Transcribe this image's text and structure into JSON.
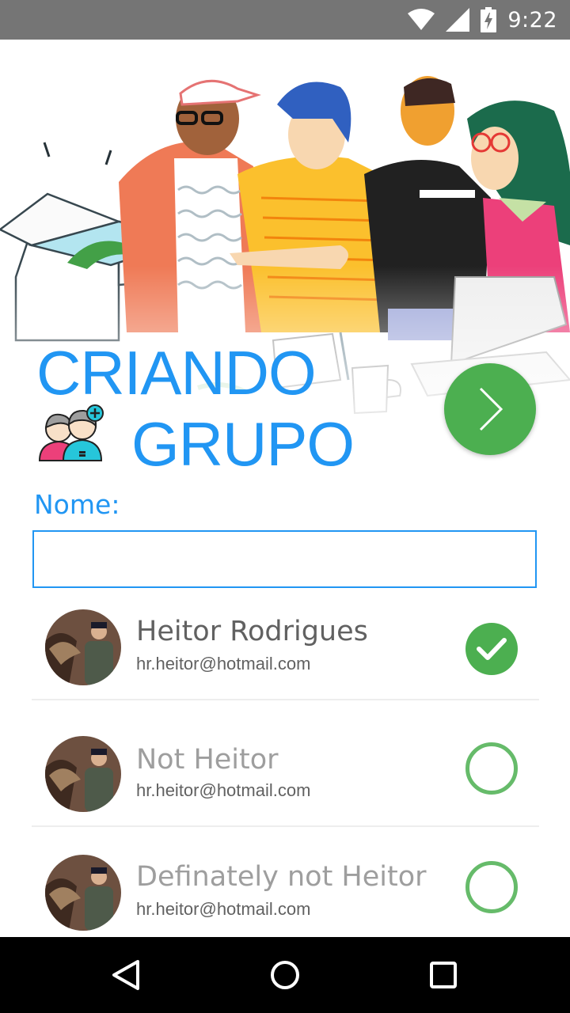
{
  "status_bar": {
    "time": "9:22",
    "icons": [
      "wifi-icon",
      "signal-icon",
      "battery-charging-icon"
    ],
    "background": "#757575"
  },
  "header": {
    "title_line1": "CRIANDO",
    "title_line2": "GRUPO",
    "title_color": "#2196f3",
    "group_icon": "group-add-icon",
    "next_icon": "chevron-right-icon",
    "next_color": "#4caf50"
  },
  "form": {
    "name_label": "Nome:",
    "name_value": "",
    "name_placeholder": ""
  },
  "contacts": [
    {
      "name": "Heitor Rodrigues",
      "email": "hr.heitor@hotmail.com",
      "selected": true
    },
    {
      "name": "Not Heitor",
      "email": "hr.heitor@hotmail.com",
      "selected": false
    },
    {
      "name": "Definately not Heitor",
      "email": "hr.heitor@hotmail.com",
      "selected": false
    }
  ],
  "nav_bar": {
    "buttons": [
      "back-icon",
      "home-icon",
      "recents-icon"
    ]
  },
  "colors": {
    "accent_blue": "#2196f3",
    "accent_green": "#4caf50",
    "selected_name": "#616161",
    "unselected_name": "#9e9e9e"
  }
}
